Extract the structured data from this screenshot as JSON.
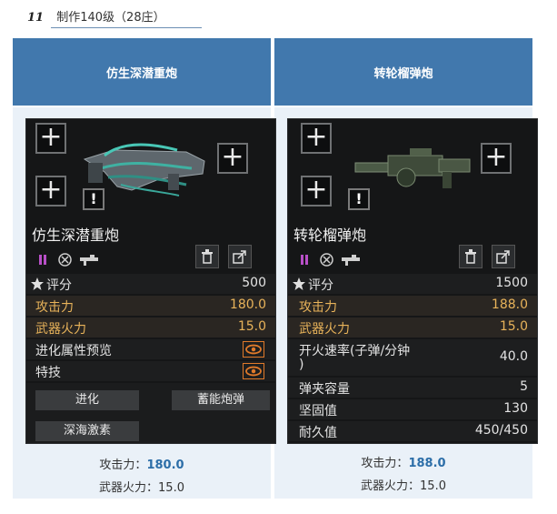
{
  "header": {
    "number": "11",
    "text": "制作140级（28庄）"
  },
  "columns": [
    {
      "title": "仿生深潜重炮",
      "card": {
        "weapon_name": "仿生深潜重炮",
        "rating_label": "评分",
        "rating_value": "500",
        "attack_label": "攻击力",
        "attack_value": "180.0",
        "fire_label": "武器火力",
        "fire_value": "15.0",
        "evo_label": "进化属性预览",
        "skill_label": "特技",
        "btn_evolve": "进化",
        "btn_charge": "蓄能炮弹",
        "btn_deep": "深海激素"
      },
      "caption": {
        "attack_label": "攻击力：",
        "attack_value": "180.0",
        "fire_label": "武器火力：",
        "fire_value": "15.0"
      }
    },
    {
      "title": "转轮榴弹炮",
      "card": {
        "weapon_name": "转轮榴弹炮",
        "rating_label": "评分",
        "rating_value": "1500",
        "attack_label": "攻击力",
        "attack_value": "188.0",
        "fire_label": "武器火力",
        "fire_value": "15.0",
        "rate_label_1": "开火速率(子弹/分钟",
        "rate_label_2": ")",
        "rate_value": "40.0",
        "mag_label": "弹夹容量",
        "mag_value": "5",
        "solid_label": "坚固值",
        "solid_value": "130",
        "dur_label": "耐久值",
        "dur_value": "450/450"
      },
      "caption": {
        "attack_label": "攻击力：",
        "attack_value": "188.0",
        "fire_label": "武器火力：",
        "fire_value": "15.0"
      }
    }
  ],
  "colors": {
    "table_header": "#4178ad",
    "cell_bg": "#eaf1f8",
    "gold": "#e8b35a",
    "value_blue": "#2c6ea8"
  }
}
